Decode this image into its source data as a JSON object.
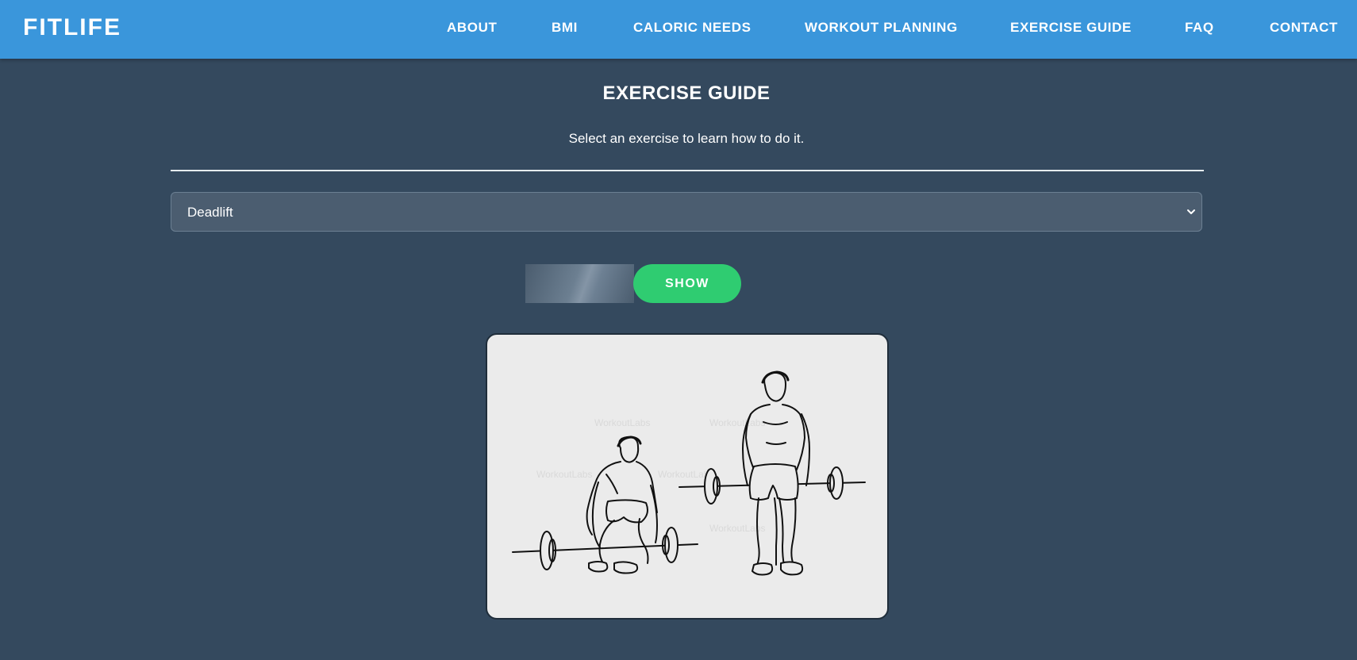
{
  "brand": {
    "name": "FITLIFE"
  },
  "nav": {
    "items": [
      {
        "label": "ABOUT"
      },
      {
        "label": "BMI"
      },
      {
        "label": "CALORIC NEEDS"
      },
      {
        "label": "WORKOUT PLANNING"
      },
      {
        "label": "EXERCISE GUIDE"
      },
      {
        "label": "FAQ"
      },
      {
        "label": "CONTACT"
      }
    ]
  },
  "main": {
    "title": "EXERCISE GUIDE",
    "subtitle": "Select an exercise to learn how to do it.",
    "exercise_select": {
      "value": "Deadlift"
    },
    "show_label": "SHOW",
    "image": {
      "watermark": "WorkoutLabs"
    }
  },
  "colors": {
    "header": "#3a96db",
    "background": "#34495e",
    "accent": "#2fcc71",
    "select_bg": "#4b5d70"
  }
}
